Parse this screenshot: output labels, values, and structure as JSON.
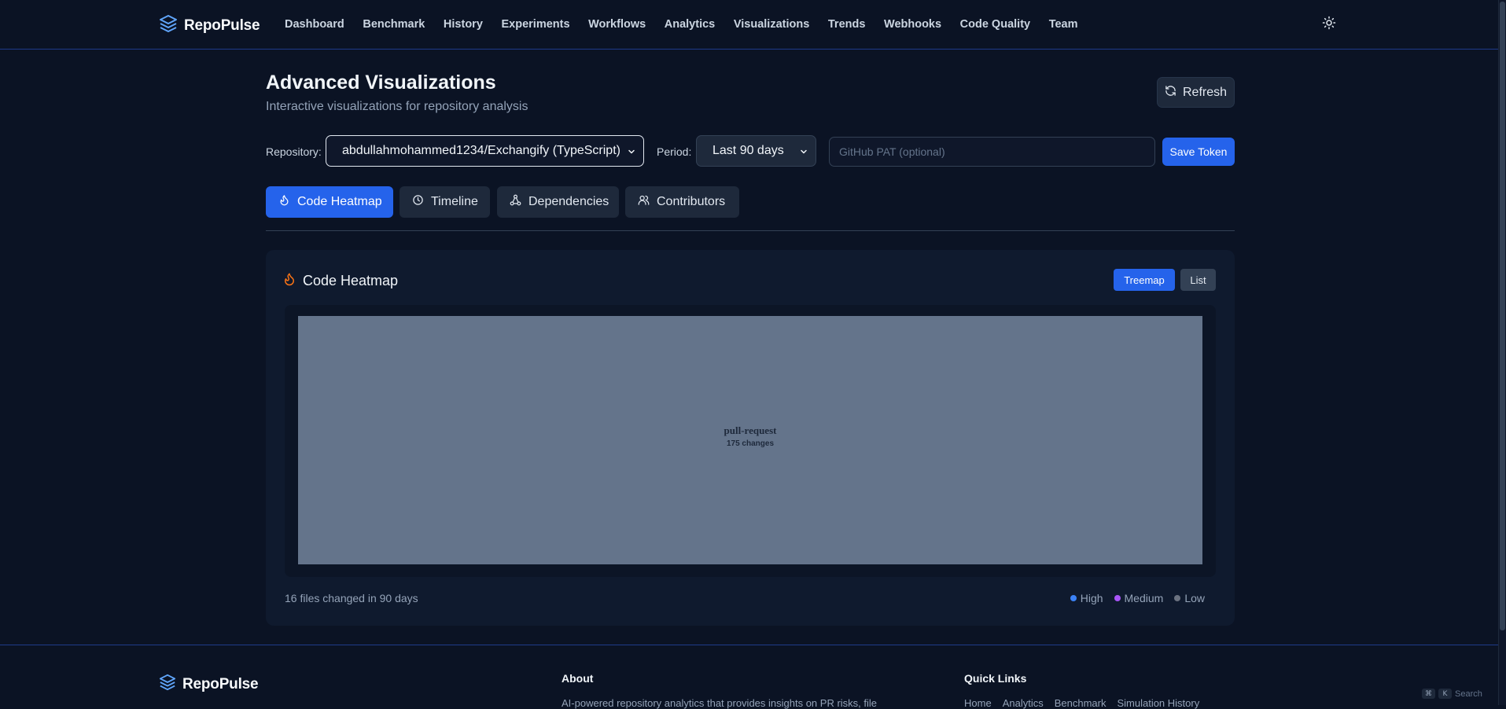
{
  "navbar": {
    "brand": "RepoPulse",
    "brand_icon": "layers-icon",
    "links": [
      "Dashboard",
      "Benchmark",
      "History",
      "Experiments",
      "Workflows",
      "Analytics",
      "Visualizations",
      "Trends",
      "Webhooks",
      "Code Quality",
      "Team"
    ],
    "theme_icon": "sun-icon"
  },
  "header": {
    "title": "Advanced Visualizations",
    "subtitle": "Interactive visualizations for repository analysis",
    "refresh_label": "Refresh"
  },
  "controls": {
    "repository_label": "Repository:",
    "repository_value": "abdullahmohammed1234/Exchangify (TypeScript)",
    "period_label": "Period:",
    "period_value": "Last 90 days",
    "pat_placeholder": "GitHub PAT (optional)",
    "pat_value": "",
    "save_label": "Save Token"
  },
  "tabs": [
    {
      "label": "Code Heatmap",
      "icon": "flame-icon",
      "active": true
    },
    {
      "label": "Timeline",
      "icon": "clock-icon",
      "active": false
    },
    {
      "label": "Dependencies",
      "icon": "network-icon",
      "active": false
    },
    {
      "label": "Contributors",
      "icon": "users-icon",
      "active": false
    }
  ],
  "heatmap": {
    "title": "Code Heatmap",
    "view_treemap": "Treemap",
    "view_list": "List",
    "active_view": "Treemap",
    "cell_name": "pull-request",
    "cell_changes": "175 changes",
    "summary": "16 files changed in 90 days",
    "legend": [
      {
        "label": "High",
        "color": "#3b82f6"
      },
      {
        "label": "Medium",
        "color": "#a855f7"
      },
      {
        "label": "Low",
        "color": "#6b7280"
      }
    ]
  },
  "footer": {
    "brand": "RepoPulse",
    "about_heading": "About",
    "about_text": "AI-powered repository analytics that provides insights on PR risks, file",
    "quick_links_heading": "Quick Links",
    "quick_links": [
      "Home",
      "Analytics",
      "Benchmark",
      "Simulation History"
    ],
    "search_hint": "Search",
    "search_keys": [
      "⌘",
      "K"
    ]
  },
  "colors": {
    "background": "#0b1324",
    "accent": "#2563eb",
    "heat_flame": "#f97316",
    "cell_low": "#64748b"
  }
}
